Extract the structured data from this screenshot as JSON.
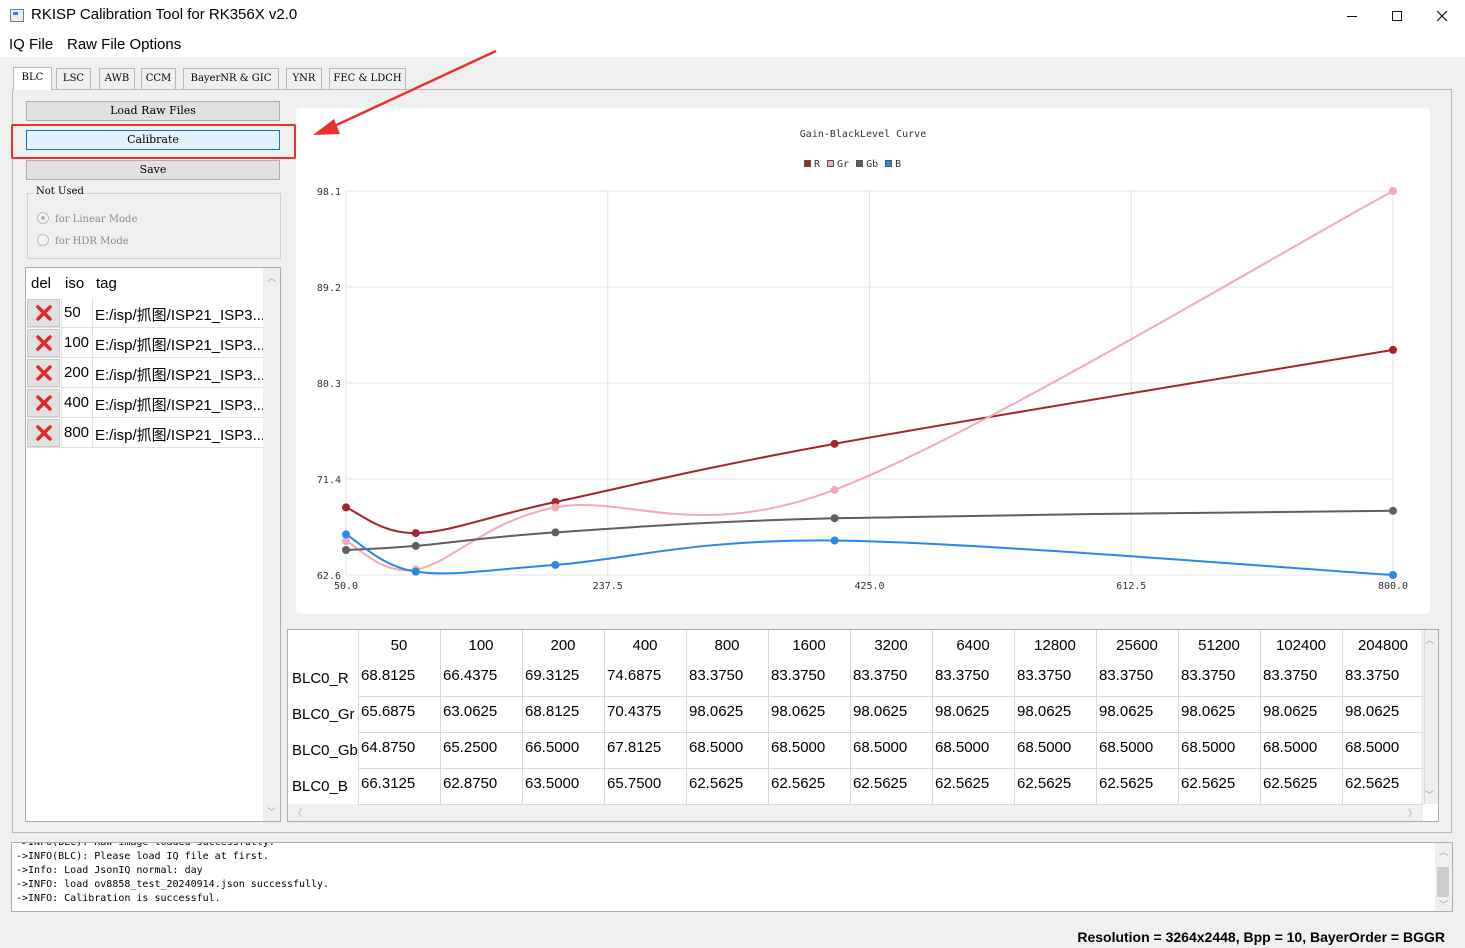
{
  "window": {
    "title": "RKISP Calibration Tool for RK356X v2.0",
    "minimize_label": "—",
    "maximize_label": "☐",
    "close_label": "✕"
  },
  "menu": {
    "items": [
      "IQ File",
      "Raw File Options"
    ]
  },
  "tabs": [
    "BLC",
    "LSC",
    "AWB",
    "CCM",
    "BayerNR & GIC",
    "YNR",
    "FEC & LDCH"
  ],
  "active_tab": "BLC",
  "left_panel": {
    "load_button": "Load Raw Files",
    "calibrate_button": "Calibrate",
    "save_button": "Save",
    "group_title": "Not Used",
    "radio_linear": "for Linear Mode",
    "radio_hdr": "for HDR Mode"
  },
  "file_table": {
    "headers": [
      "del",
      "iso",
      "tag"
    ],
    "rows": [
      {
        "iso": "50",
        "tag": "E:/isp/抓图/ISP21_ISP3..."
      },
      {
        "iso": "100",
        "tag": "E:/isp/抓图/ISP21_ISP3..."
      },
      {
        "iso": "200",
        "tag": "E:/isp/抓图/ISP21_ISP3..."
      },
      {
        "iso": "400",
        "tag": "E:/isp/抓图/ISP21_ISP3..."
      },
      {
        "iso": "800",
        "tag": "E:/isp/抓图/ISP21_ISP3..."
      }
    ],
    "delete_icon_color": "#e02b2b"
  },
  "chart_data": {
    "type": "line",
    "title": "Gain-BlackLevel Curve",
    "x": [
      50,
      100,
      200,
      400,
      800
    ],
    "x_ticks": [
      "50.0",
      "237.5",
      "425.0",
      "612.5",
      "800.0"
    ],
    "y_ticks": [
      "62.6",
      "71.4",
      "80.3",
      "89.2",
      "98.1"
    ],
    "xlim": [
      50,
      800
    ],
    "ylim": [
      62.5625,
      98.0625
    ],
    "grid": true,
    "legend_position": "top-center",
    "series": [
      {
        "name": "R",
        "color": "#a8232b",
        "values": [
          68.8125,
          66.4375,
          69.3125,
          74.6875,
          83.375
        ]
      },
      {
        "name": "Gr",
        "color": "#f4a9b8",
        "values": [
          65.6875,
          63.0625,
          68.8125,
          70.4375,
          98.0625
        ]
      },
      {
        "name": "Gb",
        "color": "#5e5e5e",
        "values": [
          64.875,
          65.25,
          66.5,
          67.8125,
          68.5
        ]
      },
      {
        "name": "B",
        "color": "#2a86e8",
        "values": [
          66.3125,
          62.875,
          63.5,
          65.75,
          62.5625
        ]
      }
    ]
  },
  "data_table": {
    "columns": [
      "50",
      "100",
      "200",
      "400",
      "800",
      "1600",
      "3200",
      "6400",
      "12800",
      "25600",
      "51200",
      "102400",
      "204800"
    ],
    "rows": [
      {
        "label": "BLC0_R",
        "values": [
          "68.8125",
          "66.4375",
          "69.3125",
          "74.6875",
          "83.3750",
          "83.3750",
          "83.3750",
          "83.3750",
          "83.3750",
          "83.3750",
          "83.3750",
          "83.3750",
          "83.3750"
        ]
      },
      {
        "label": "BLC0_Gr",
        "values": [
          "65.6875",
          "63.0625",
          "68.8125",
          "70.4375",
          "98.0625",
          "98.0625",
          "98.0625",
          "98.0625",
          "98.0625",
          "98.0625",
          "98.0625",
          "98.0625",
          "98.0625"
        ]
      },
      {
        "label": "BLC0_Gb",
        "values": [
          "64.8750",
          "65.2500",
          "66.5000",
          "67.8125",
          "68.5000",
          "68.5000",
          "68.5000",
          "68.5000",
          "68.5000",
          "68.5000",
          "68.5000",
          "68.5000",
          "68.5000"
        ]
      },
      {
        "label": "BLC0_B",
        "values": [
          "66.3125",
          "62.8750",
          "63.5000",
          "65.7500",
          "62.5625",
          "62.5625",
          "62.5625",
          "62.5625",
          "62.5625",
          "62.5625",
          "62.5625",
          "62.5625",
          "62.5625"
        ]
      }
    ]
  },
  "log": {
    "lines": [
      "->INFO(BLC): Raw image loaded successfully.",
      "->INFO(BLC): Please load IQ file at first.",
      "->Info: Load JsonIQ normal: day",
      "->INFO: load ov8858_test_20240914.json successfully.",
      "->INFO: Calibration is successful."
    ]
  },
  "status": {
    "text": "Resolution = 3264x2448, Bpp = 10, BayerOrder = BGGR"
  },
  "annotation_color": "#e8322b"
}
